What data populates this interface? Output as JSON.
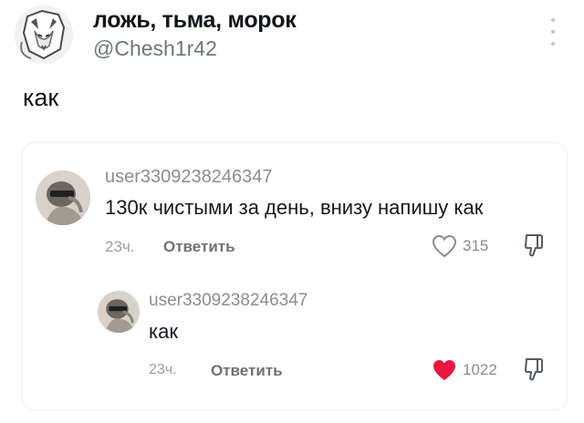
{
  "post": {
    "display_name": "ложь, тьма, морок",
    "handle": "@Chesh1r42",
    "text": "как",
    "avatar_icon": "fox-mask-emblem-icon",
    "more_icon": "more-vertical-icon"
  },
  "comments": [
    {
      "username": "user3309238246347",
      "text": "130к чистыми за день, внизу напишу как",
      "time": "23ч.",
      "reply_label": "Ответить",
      "likes": "315",
      "liked": false,
      "avatar_icon": "statue-avatar-icon"
    },
    {
      "username": "user3309238246347",
      "text": "как",
      "time": "23ч.",
      "reply_label": "Ответить",
      "likes": "1022",
      "liked": true,
      "avatar_icon": "statue-avatar-icon"
    }
  ],
  "colors": {
    "like_active": "#e8173d",
    "muted": "#8a8d91"
  }
}
